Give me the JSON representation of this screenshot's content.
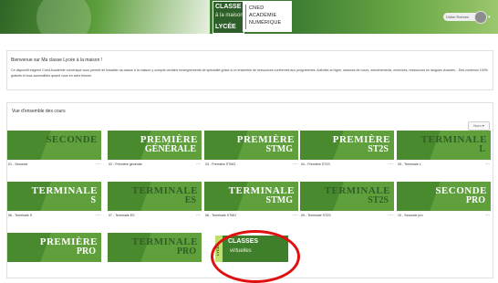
{
  "header": {
    "logo_classe": "CLASSE",
    "logo_maison": "à la maison",
    "logo_lycee": "LYCÉE",
    "cned_line1": "CNED",
    "cned_line2": "ACADÉMIE",
    "cned_line3": "NUMÉRIQUE",
    "user_label": "Didier Reimes",
    "colors": {
      "banner_green": "#3e7a32"
    }
  },
  "welcome": {
    "title": "Bienvenue sur Ma classe Lycée à la maison !",
    "text": "Ce dispositif exigené Cned Académie numérique vous permet de travailler sa classe à la maison y compris certains enseignements de spécialité grâce à un ensemble de ressources conformes aux programmes. Activités en ligne, séances de cours, entraînements, exercices, ressources en langues vivantes... Des contenus 100% gratuits et tous accessibles quand vous en avez besoin."
  },
  "courses": {
    "title": "Vue d'ensemble des cours",
    "sort_label": "Nom ▾",
    "items": [
      {
        "label": "01 - Seconde",
        "word": "SECONDE",
        "sub": "",
        "text_color": "#2f5e27"
      },
      {
        "label": "02 - Première générale",
        "word": "PREMIÈRE",
        "sub": "GÉNÉRALE",
        "text_color": "#ffffff"
      },
      {
        "label": "03 - Première STMG",
        "word": "PREMIÈRE",
        "sub": "STMG",
        "text_color": "#ffffff"
      },
      {
        "label": "04 - Première ST2S",
        "word": "PREMIÈRE",
        "sub": "ST2S",
        "text_color": "#ffffff"
      },
      {
        "label": "05 - Terminale L",
        "word": "TERMINALE",
        "sub": "L",
        "text_color": "#2f5e27"
      },
      {
        "label": "06 - Terminale S",
        "word": "TERMINALE",
        "sub": "S",
        "text_color": "#ffffff"
      },
      {
        "label": "07 - Terminale ES",
        "word": "TERMINALE",
        "sub": "ES",
        "text_color": "#2f5e27"
      },
      {
        "label": "08 - Terminale STMG",
        "word": "TERMINALE",
        "sub": "STMG",
        "text_color": "#ffffff"
      },
      {
        "label": "09 - Terminale ST2S",
        "word": "TERMINALE",
        "sub": "ST2S",
        "text_color": "#2f5e27"
      },
      {
        "label": "10 - Seconde pro",
        "word": "SECONDE",
        "sub": "PRO",
        "text_color": "#ffffff"
      },
      {
        "label": "",
        "word": "PREMIÈRE",
        "sub": "PRO",
        "text_color": "#ffffff"
      },
      {
        "label": "",
        "word": "TERMINALE",
        "sub": "PRO",
        "text_color": "#2f5e27"
      }
    ],
    "classes_virtuelles": {
      "vertical": "LYCÉE",
      "title": "CLASSES",
      "sub": "virtuelles"
    }
  }
}
